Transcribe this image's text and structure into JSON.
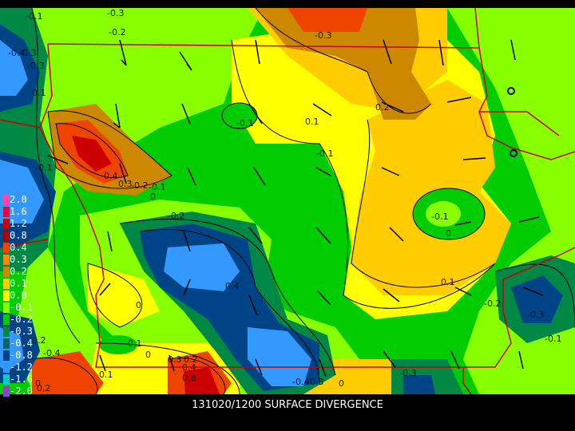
{
  "title": "131020/1200 SURFACE DIVERGENCE",
  "colors": {
    "background": "#000000",
    "field_zero": "#ffff00",
    "pos_weak": "#ffcc00",
    "pos_mid": "#cc8800",
    "pos_strong": "#ee4400",
    "pos_max": "#cc0000",
    "neg_weak": "#88ff00",
    "neg_mid": "#00cc00",
    "neg_strong": "#008844",
    "neg_deep": "#004488",
    "neg_max": "#3399ff",
    "state_border": "#cc0000",
    "wind_barb": "#000000"
  },
  "legend": [
    {
      "label": "2.0",
      "color": "#ff44aa"
    },
    {
      "label": "1.6",
      "color": "#ee0044"
    },
    {
      "label": "1.2",
      "color": "#cc0000"
    },
    {
      "label": "0.8",
      "color": "#aa0000"
    },
    {
      "label": "0.4",
      "color": "#ee4400"
    },
    {
      "label": "0.3",
      "color": "#ff8800"
    },
    {
      "label": "0.2",
      "color": "#cc8800"
    },
    {
      "label": "0.1",
      "color": "#ffcc00"
    },
    {
      "label": "0.0",
      "color": "#ffff00"
    },
    {
      "label": "-0.1",
      "color": "#88ff00"
    },
    {
      "label": "-0.2",
      "color": "#00cc00"
    },
    {
      "label": "-0.3",
      "color": "#008844"
    },
    {
      "label": "-0.4",
      "color": "#006666"
    },
    {
      "label": "-0.8",
      "color": "#004488"
    },
    {
      "label": "-1.2",
      "color": "#3399ff"
    },
    {
      "label": "-1.6",
      "color": "#00cccc"
    },
    {
      "label": "-2.0",
      "color": "#8844cc"
    }
  ],
  "contour_labels": [
    "-0.1",
    "-0.3",
    "-0.2",
    "-0.4",
    "-0.3",
    "-0.3",
    "0.2",
    "0.1",
    "-0.1",
    "0.1",
    "-0.1",
    "0.4",
    "0.3",
    "-0.2",
    "-0.1",
    "0",
    "-0.1",
    "-0.2",
    "-0.1",
    "0",
    "0.4",
    "0",
    "0.1",
    "-0.2",
    "-0.3",
    "-0.1",
    "0",
    "-0.1",
    "0",
    "0.1",
    "0.2",
    "-0.4",
    "0.3",
    "0.2",
    "0.4",
    "0.8",
    "-0.3",
    "-0.4",
    "-0.3",
    "0",
    "-0.3",
    "0.2"
  ]
}
